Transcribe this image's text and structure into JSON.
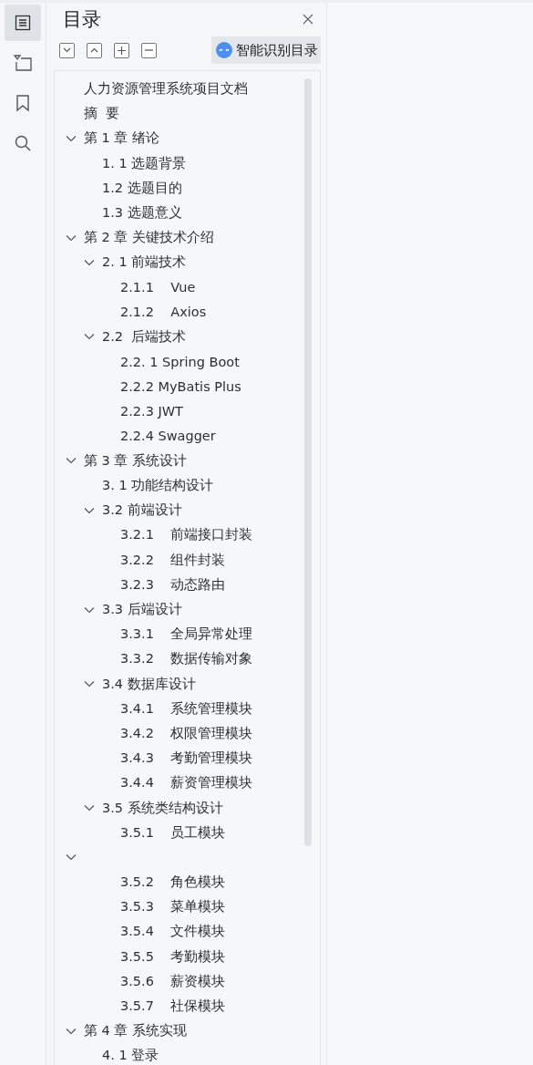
{
  "rail": [
    {
      "selected": true
    },
    {
      "selected": false
    },
    {
      "selected": false
    },
    {
      "selected": false
    }
  ],
  "panel": {
    "title": "目录",
    "smart_button": "智能识别目录"
  },
  "toc": [
    {
      "label": "人力资源管理系统项目文档"
    },
    {
      "label": "摘  要"
    },
    {
      "label": "第 1 章 绪论",
      "expanded": true,
      "children": [
        {
          "label": "1. 1 选题背景"
        },
        {
          "label": "1.2 选题目的"
        },
        {
          "label": "1.3 选题意义"
        }
      ]
    },
    {
      "label": "第 2 章 关键技术介绍",
      "expanded": true,
      "children": [
        {
          "label": "2. 1 前端技术",
          "expanded": true,
          "children": [
            {
              "label": "2.1.1    Vue"
            },
            {
              "label": "2.1.2    Axios"
            }
          ]
        },
        {
          "label": "2.2  后端技术",
          "expanded": true,
          "children": [
            {
              "label": "2.2. 1 Spring Boot"
            },
            {
              "label": "2.2.2 MyBatis Plus"
            },
            {
              "label": "2.2.3 JWT"
            },
            {
              "label": "2.2.4 Swagger"
            }
          ]
        }
      ]
    },
    {
      "label": "第 3 章 系统设计",
      "expanded": true,
      "children": [
        {
          "label": "3. 1 功能结构设计"
        },
        {
          "label": "3.2 前端设计",
          "expanded": true,
          "children": [
            {
              "label": "3.2.1    前端接口封装"
            },
            {
              "label": "3.2.2    组件封装"
            },
            {
              "label": "3.2.3    动态路由"
            }
          ]
        },
        {
          "label": "3.3 后端设计",
          "expanded": true,
          "children": [
            {
              "label": "3.3.1    全局异常处理"
            },
            {
              "label": "3.3.2    数据传输对象"
            }
          ]
        },
        {
          "label": "3.4 数据库设计",
          "expanded": true,
          "children": [
            {
              "label": "3.4.1    系统管理模块"
            },
            {
              "label": "3.4.2    权限管理模块"
            },
            {
              "label": "3.4.3    考勤管理模块"
            },
            {
              "label": "3.4.4    薪资管理模块"
            }
          ]
        },
        {
          "label": "3.5 系统类结构设计",
          "expanded": true,
          "children": [
            {
              "label": "3.5.1    员工模块"
            }
          ]
        }
      ]
    },
    {
      "expanded": true,
      "children": [
        {
          "label": "3.5.2    角色模块"
        },
        {
          "label": "3.5.3    菜单模块"
        },
        {
          "label": "3.5.4    文件模块"
        },
        {
          "label": "3.5.5    考勤模块"
        },
        {
          "label": "3.5.6    薪资模块"
        },
        {
          "label": "3.5.7    社保模块"
        }
      ]
    },
    {
      "label": "第 4 章 系统实现",
      "expanded": true,
      "children": [
        {
          "label": "4. 1 登录"
        }
      ]
    }
  ]
}
